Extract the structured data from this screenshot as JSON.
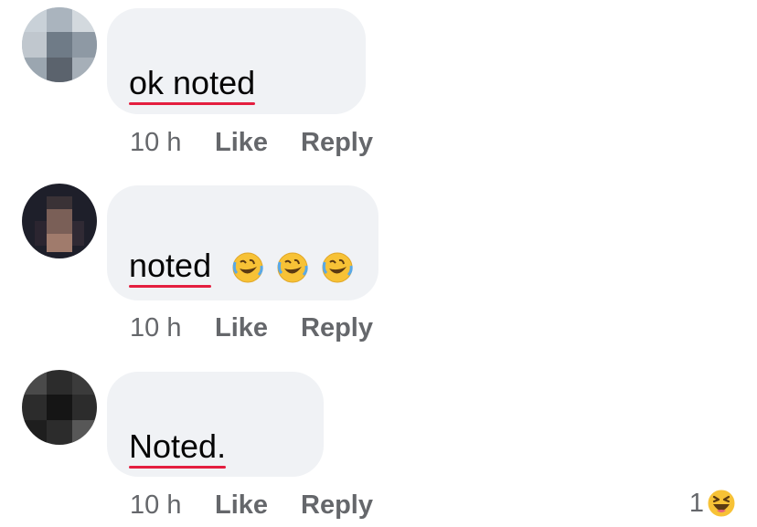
{
  "comments": [
    {
      "author_name": "",
      "text": "ok noted",
      "misspelled_words": [
        "ok noted"
      ],
      "emojis": [],
      "time": "10 h",
      "like_label": "Like",
      "reply_label": "Reply"
    },
    {
      "author_name": "",
      "text": "noted",
      "misspelled_words": [
        "noted"
      ],
      "emojis": [
        "rolling-on-floor-laughing-emoji",
        "rolling-on-floor-laughing-emoji",
        "rolling-on-floor-laughing-emoji"
      ],
      "time": "10 h",
      "like_label": "Like",
      "reply_label": "Reply"
    },
    {
      "author_name": "",
      "text": "Noted.",
      "misspelled_words": [
        "Noted."
      ],
      "emojis": [],
      "time": "10 h",
      "like_label": "Like",
      "reply_label": "Reply",
      "reaction": {
        "count": "1",
        "icon": "haha-reaction-icon"
      }
    }
  ],
  "colors": {
    "bubble": "#f0f2f5",
    "text": "#050505",
    "meta": "#65676b",
    "spellcheck_underline": "#e41e3f",
    "emoji_yellow": "#f7c236"
  }
}
